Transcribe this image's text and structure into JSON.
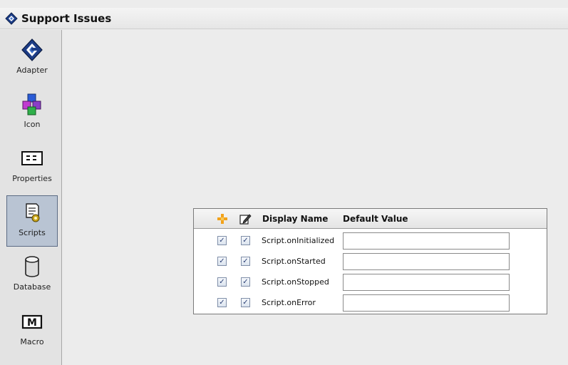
{
  "window": {
    "title": "Support Issues"
  },
  "sidebar": {
    "items": [
      {
        "label": "Adapter",
        "icon": "adapter-icon",
        "selected": false
      },
      {
        "label": "Icon",
        "icon": "puzzle-icon",
        "selected": false
      },
      {
        "label": "Properties",
        "icon": "properties-icon",
        "selected": false
      },
      {
        "label": "Scripts",
        "icon": "script-icon",
        "selected": true
      },
      {
        "label": "Database",
        "icon": "database-icon",
        "selected": false
      },
      {
        "label": "Macro",
        "icon": "macro-icon",
        "selected": false
      }
    ]
  },
  "table": {
    "headers": {
      "add_icon": "add-icon",
      "edit_icon": "edit-icon",
      "display_name": "Display Name",
      "default_value": "Default Value"
    },
    "rows": [
      {
        "name": "Script.onInitialized",
        "value": "",
        "checked_a": true,
        "checked_b": true
      },
      {
        "name": "Script.onStarted",
        "value": "",
        "checked_a": true,
        "checked_b": true
      },
      {
        "name": "Script.onStopped",
        "value": "",
        "checked_a": true,
        "checked_b": true
      },
      {
        "name": "Script.onError",
        "value": "",
        "checked_a": true,
        "checked_b": true
      }
    ],
    "check_glyph": "✓"
  },
  "colors": {
    "selection_bg": "#b9c4d3",
    "selection_border": "#5b6b84"
  }
}
